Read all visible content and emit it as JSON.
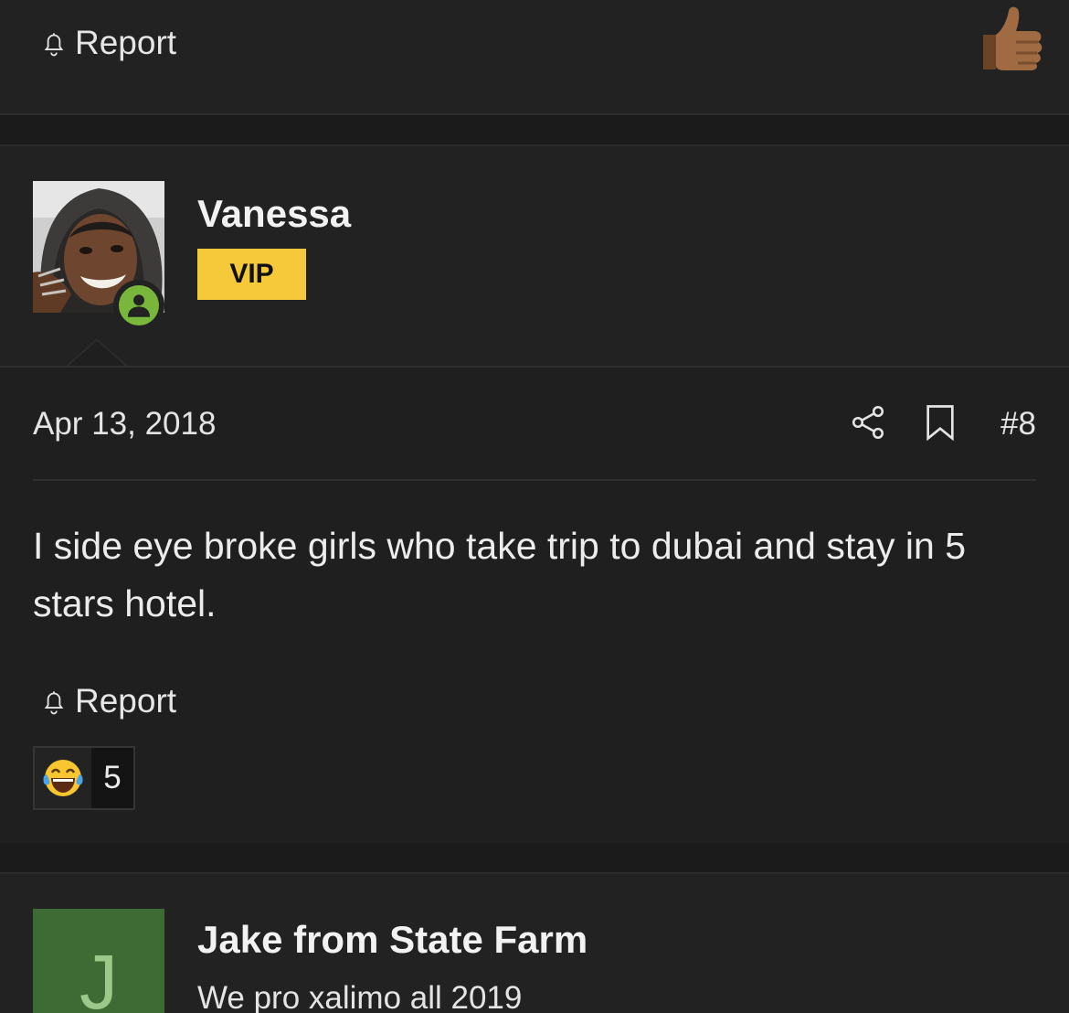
{
  "previous_post": {
    "report_label": "Report",
    "reaction_icon": "thumbs-up-icon"
  },
  "post": {
    "author": "Vanessa",
    "badge": "VIP",
    "status": "online",
    "date": "Apr 13, 2018",
    "post_number": "#8",
    "message": "I side eye broke girls who take trip to dubai and stay in 5 stars hotel.",
    "report_label": "Report",
    "reaction": {
      "icon": "laughing-tears-emoji",
      "count": "5"
    }
  },
  "next_post": {
    "author": "Jake from State Farm",
    "avatar_letter": "J",
    "user_title": "We pro xalimo all 2019"
  },
  "colors": {
    "background": "#1b1b1b",
    "card": "#222222",
    "vip_badge": "#f5c93a",
    "online_indicator": "#78b73b",
    "avatar_j_bg": "#3e6b33"
  }
}
